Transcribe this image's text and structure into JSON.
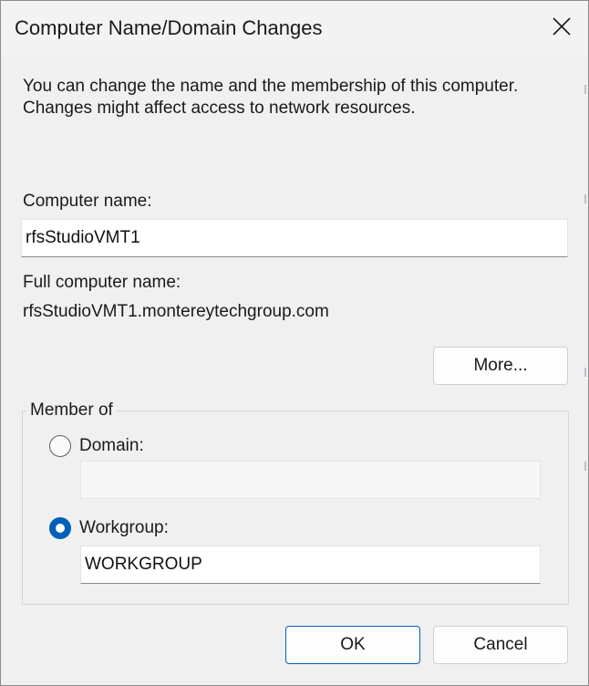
{
  "window": {
    "title": "Computer Name/Domain Changes",
    "close_icon": "close-icon"
  },
  "intro_text": "You can change the name and the membership of this computer. Changes might affect access to network resources.",
  "computer_name": {
    "label": "Computer name:",
    "value": "rfsStudioVMT1"
  },
  "full_computer_name": {
    "label": "Full computer name:",
    "value": "rfsStudioVMT1.montereytechgroup.com"
  },
  "more_button_label": "More...",
  "member_of": {
    "legend": "Member of",
    "domain": {
      "label": "Domain:",
      "selected": false,
      "value": ""
    },
    "workgroup": {
      "label": "Workgroup:",
      "selected": true,
      "value": "WORKGROUP"
    }
  },
  "buttons": {
    "ok": "OK",
    "cancel": "Cancel"
  },
  "colors": {
    "accent": "#005fb8",
    "dialog_background": "#f0f0f0"
  }
}
